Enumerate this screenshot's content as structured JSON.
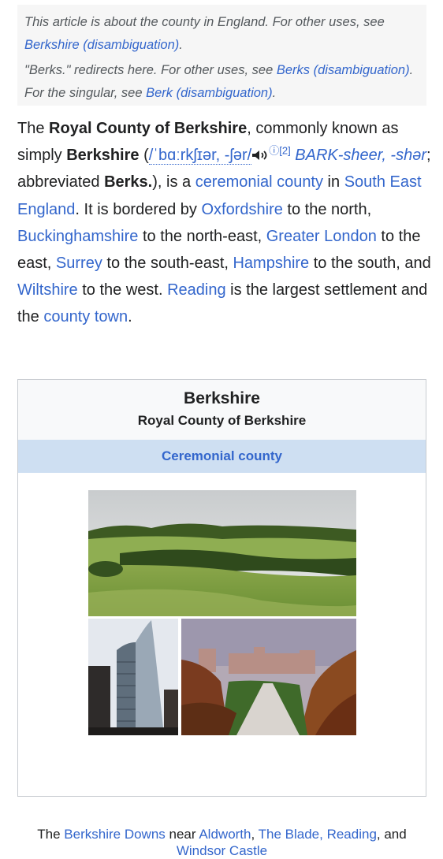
{
  "hatnote": {
    "line1_prefix": "This article is about the county in England. For other uses, see",
    "line1_link": "Berkshire (disambiguation)",
    "line1_suffix": ".",
    "line2_prefix": "\"Berks.\" redirects here. For other uses, see",
    "line2_link1": "Berks (disambiguation)",
    "line2_mid": ". For the singular, see",
    "line2_link2": "Berk (disambiguation)",
    "line2_suffix": "."
  },
  "lead": {
    "t1": "The ",
    "b1": "Royal County of Berkshire",
    "t2": ", commonly known as simply ",
    "b2": "Berkshire",
    "t3": " (",
    "ipa": "/ˈbɑːrkʃɪər, -ʃər/",
    "info_mark": "ⓘ",
    "ref": "[2]",
    "respell": "BARK-sheer, -shər",
    "t4": "; abbreviated ",
    "b3": "Berks.",
    "t5": "), is a ",
    "l_ceremonial": "ceremonial county",
    "t6": " in ",
    "l_see": "South East England",
    "t7": ". It is bordered by ",
    "l_oxon": "Oxfordshire",
    "t8": " to the north, ",
    "l_bucks": "Buckinghamshire",
    "t9": " to the north-east, ",
    "l_london": "Greater London",
    "t10": " to the east, ",
    "l_surrey": "Surrey",
    "t11": " to the south-east, ",
    "l_hants": "Hampshire",
    "t12": " to the south, and ",
    "l_wilts": "Wiltshire",
    "t13": " to the west. ",
    "l_reading": "Reading",
    "t14": " is the largest settlement and the ",
    "l_county_town": "county town",
    "t15": "."
  },
  "infobox": {
    "title": "Berkshire",
    "subtitle": "Royal County of Berkshire",
    "band": "Ceremonial county",
    "caption": {
      "t1": "The ",
      "l1": "Berkshire Downs",
      "t2": " near ",
      "l2": "Aldworth",
      "t3": ", ",
      "l3": "The Blade, Reading",
      "t4": ", and ",
      "l4": "Windsor Castle"
    }
  },
  "colors": {
    "link": "#3366cc",
    "text": "#202122",
    "hatnote_bg": "#f6f6f6",
    "band_bg": "#cedff2"
  }
}
